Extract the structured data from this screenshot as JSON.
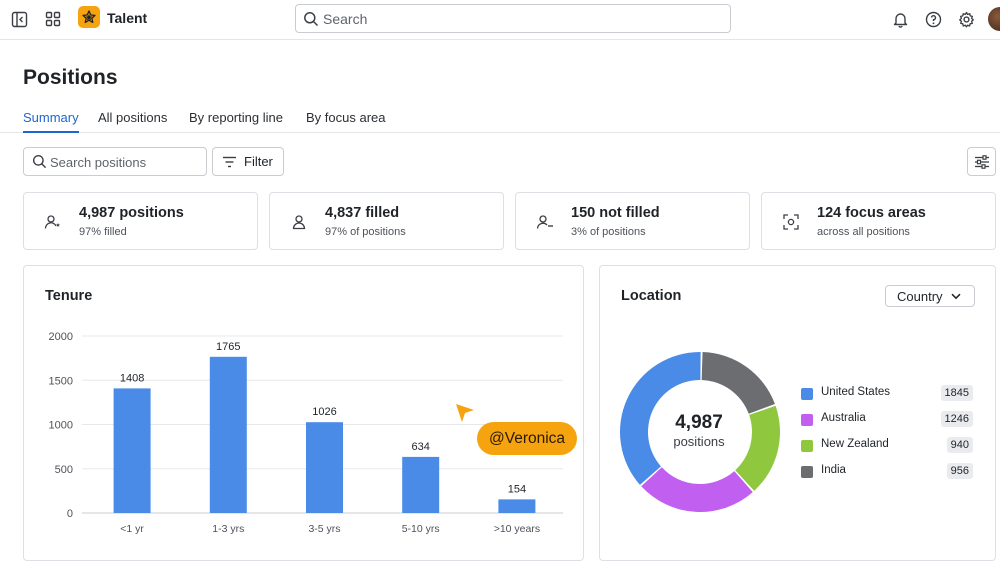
{
  "app": {
    "name": "Talent"
  },
  "search": {
    "placeholder": "Search"
  },
  "page": {
    "title": "Positions"
  },
  "tabs": [
    {
      "label": "Summary",
      "active": true
    },
    {
      "label": "All positions",
      "active": false
    },
    {
      "label": "By reporting line",
      "active": false
    },
    {
      "label": "By focus area",
      "active": false
    }
  ],
  "filters": {
    "search_placeholder": "Search positions",
    "filter_label": "Filter"
  },
  "stats": [
    {
      "title": "4,987 positions",
      "sub": "97% filled",
      "icon": "person-star-icon"
    },
    {
      "title": "4,837 filled",
      "sub": "97% of positions",
      "icon": "person-icon"
    },
    {
      "title": "150 not filled",
      "sub": "3% of positions",
      "icon": "person-minus-icon"
    },
    {
      "title": "124 focus areas",
      "sub": "across all positions",
      "icon": "focus-target-icon"
    }
  ],
  "tenure": {
    "title": "Tenure"
  },
  "location": {
    "title": "Location",
    "dropdown_label": "Country",
    "center_value": "4,987",
    "center_label": "positions"
  },
  "colors": {
    "accent": "#1e66d0",
    "bar": "#4a8be8",
    "brand": "#f5a30f",
    "united_states": "#4a8be8",
    "australia": "#c05ff0",
    "new_zealand": "#8fc83f",
    "india": "#6b6d71"
  },
  "cursor": {
    "label": "@Veronica"
  },
  "chart_data": [
    {
      "type": "bar",
      "title": "Tenure",
      "categories": [
        "<1 yr",
        "1-3 yrs",
        "3-5 yrs",
        "5-10 yrs",
        ">10 years"
      ],
      "values": [
        1408,
        1765,
        1026,
        634,
        154
      ],
      "ylim": [
        0,
        2000
      ],
      "yticks": [
        0,
        500,
        1000,
        1500,
        2000
      ],
      "grid": true
    },
    {
      "type": "pie",
      "title": "Location",
      "categories": [
        "United States",
        "Australia",
        "New Zealand",
        "India"
      ],
      "values": [
        1845,
        1246,
        940,
        956
      ],
      "legend": "right"
    }
  ]
}
